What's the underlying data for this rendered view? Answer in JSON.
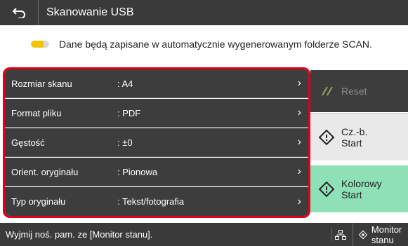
{
  "header": {
    "title": "Skanowanie USB",
    "back_icon": "back-arrow-icon"
  },
  "info": {
    "text": "Dane będą zapisane w automatycznie wygenerowanym folderze SCAN."
  },
  "settings": [
    {
      "label": "Rozmiar skanu",
      "value": ": A4"
    },
    {
      "label": "Format pliku",
      "value": ": PDF"
    },
    {
      "label": "Gęstość",
      "value": ": ±0"
    },
    {
      "label": "Orient. oryginału",
      "value": ": Pionowa"
    },
    {
      "label": "Typ oryginału",
      "value": ": Tekst/fotografia"
    }
  ],
  "buttons": {
    "reset": "Reset",
    "bw_start_line1": "Cz.-b.",
    "bw_start_line2": "Start",
    "color_start_line1": "Kolorowy",
    "color_start_line2": "Start"
  },
  "status": {
    "message": "Wyjmij noś. pam. ze [Monitor stanu].",
    "monitor_label": "Monitor stanu"
  },
  "colors": {
    "accent_red": "#e0001a",
    "color_start": "#8ee0b7",
    "usb_yellow": "#f5c400"
  }
}
